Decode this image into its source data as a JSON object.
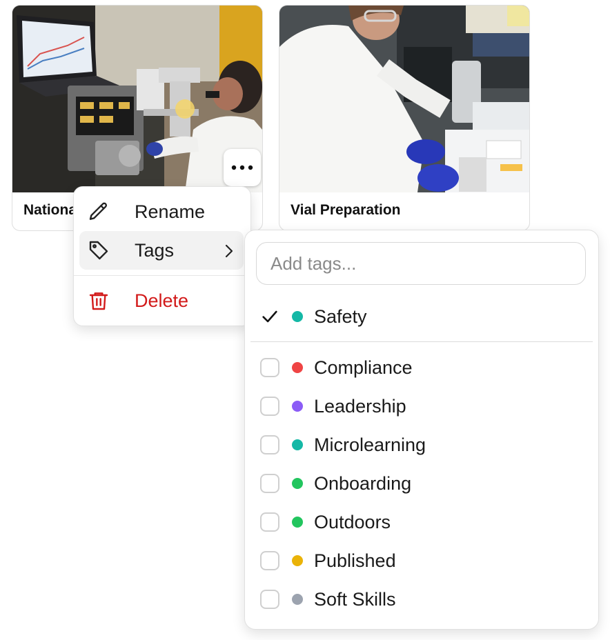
{
  "cards": [
    {
      "title": "National"
    },
    {
      "title": "Vial Preparation"
    }
  ],
  "context_menu": {
    "rename_label": "Rename",
    "tags_label": "Tags",
    "delete_label": "Delete"
  },
  "tag_panel": {
    "placeholder": "Add tags...",
    "selected": [
      {
        "label": "Safety",
        "color": "#14b8a6",
        "checked": true
      }
    ],
    "available": [
      {
        "label": "Compliance",
        "color": "#ef4444",
        "checked": false
      },
      {
        "label": "Leadership",
        "color": "#8b5cf6",
        "checked": false
      },
      {
        "label": "Microlearning",
        "color": "#14b8a6",
        "checked": false
      },
      {
        "label": "Onboarding",
        "color": "#22c55e",
        "checked": false
      },
      {
        "label": "Outdoors",
        "color": "#22c55e",
        "checked": false
      },
      {
        "label": "Published",
        "color": "#eab308",
        "checked": false
      },
      {
        "label": "Soft Skills",
        "color": "#9ca3af",
        "checked": false
      }
    ]
  }
}
